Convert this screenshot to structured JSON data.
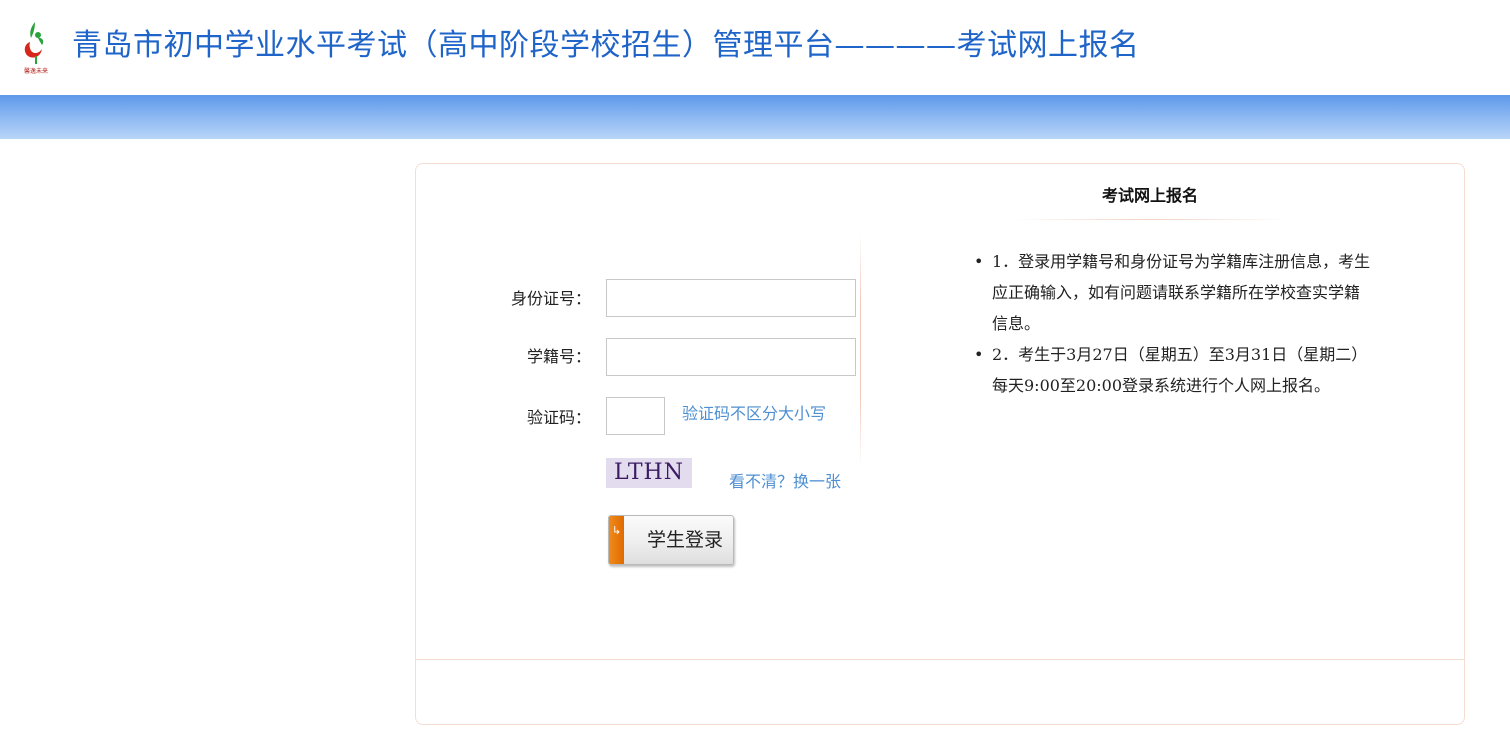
{
  "header": {
    "title": "青岛市初中学业水平考试（高中阶段学校招生）管理平台————考试网上报名",
    "logo_icon": "qingdao-education-logo-icon"
  },
  "form": {
    "id_label": "身份证号：",
    "id_value": "",
    "student_no_label": "学籍号：",
    "student_no_value": "",
    "captcha_label": "验证码：",
    "captcha_value": "",
    "captcha_hint": "验证码不区分大小写",
    "captcha_text": "LTHN",
    "refresh_link": "看不清？换一张",
    "login_button": "学生登录"
  },
  "notice": {
    "title": "考试网上报名",
    "items": [
      "1．登录用学籍号和身份证号为学籍库注册信息，考生应正确输入，如有问题请联系学籍所在学校查实学籍信息。",
      "2．考生于3月27日（星期五）至3月31日（星期二）每天9:00至20:00登录系统进行个人网上报名。"
    ]
  },
  "colors": {
    "title_blue": "#1f64c8",
    "banner_top": "#5f98ea",
    "banner_bottom": "#b8d5f7",
    "link_blue": "#4d8fd1",
    "button_accent": "#f08a1c"
  }
}
